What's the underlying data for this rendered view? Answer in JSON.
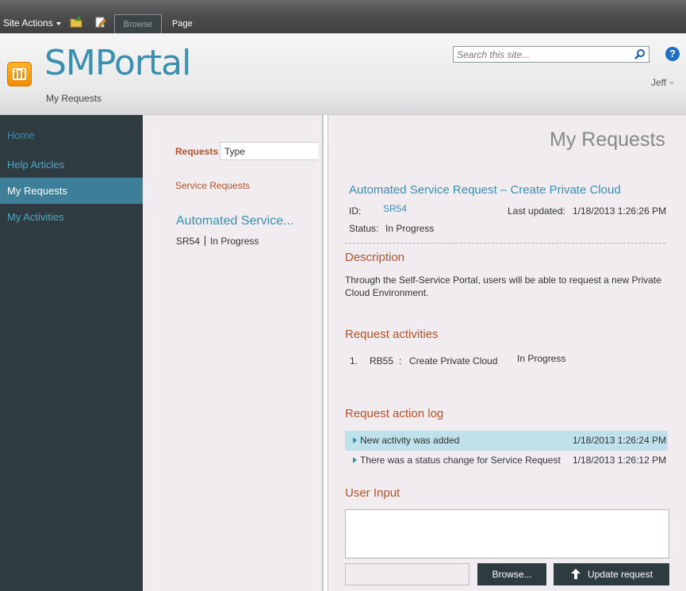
{
  "ribbon": {
    "site_actions": "Site Actions",
    "tabs": [
      {
        "label": "Browse"
      },
      {
        "label": "Page"
      }
    ]
  },
  "header": {
    "site_title": "SMPortal",
    "breadcrumb": "My Requests",
    "search_placeholder": "Search this site...",
    "help_glyph": "?",
    "user": "Jeff"
  },
  "nav": {
    "items": [
      {
        "label": "Home"
      },
      {
        "label": "Help Articles"
      },
      {
        "label": "My Requests"
      },
      {
        "label": "My Activities"
      }
    ]
  },
  "list": {
    "requests_label": "Requests",
    "type_label": "Type",
    "group_label": "Service Requests",
    "item_title": "Automated Service...",
    "item_id": "SR54",
    "item_status": "In Progress"
  },
  "detail": {
    "page_title": "My Requests",
    "request_title": "Automated Service Request – Create Private Cloud",
    "id_label": "ID:",
    "id_value": "SR54",
    "last_updated_label": "Last updated:",
    "last_updated_value": "1/18/2013 1:26:26 PM",
    "status_label": "Status:",
    "status_value": "In Progress",
    "description_heading": "Description",
    "description_text": "Through the Self-Service Portal, users will be able to request a new Private Cloud Environment.",
    "activities_heading": "Request activities",
    "activities": [
      {
        "num": "1.",
        "id": "RB55",
        "sep": ":",
        "name": "Create Private Cloud",
        "status": "In Progress"
      }
    ],
    "log_heading": "Request action log",
    "log": [
      {
        "message": "New activity was added",
        "timestamp": "1/18/2013 1:26:24 PM"
      },
      {
        "message": "There was a status change for Service Request",
        "timestamp": "1/18/2013 1:26:12 PM"
      }
    ],
    "user_input_heading": "User Input",
    "browse_label": "Browse...",
    "update_label": "Update request"
  },
  "colors": {
    "accent_blue": "#3a8fb0",
    "heading_orange": "#b4532a",
    "nav_dark": "#2e3b40",
    "nav_active": "#3d7f98",
    "log_highlight": "#bee1ec"
  }
}
